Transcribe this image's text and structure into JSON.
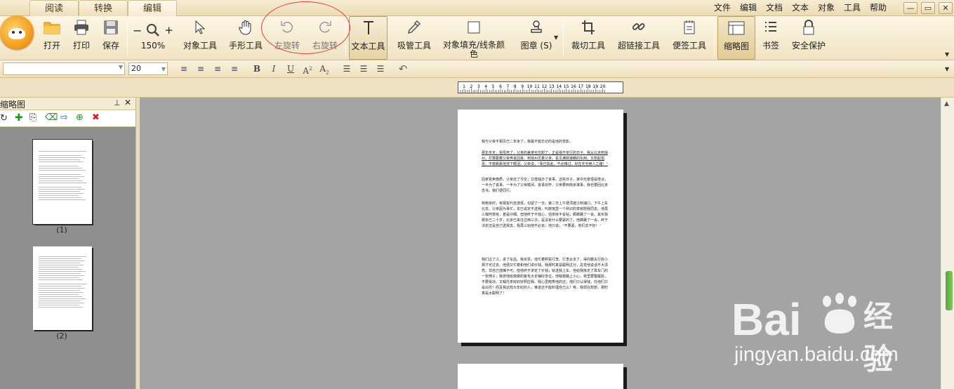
{
  "tabs": [
    "阅读",
    "转换",
    "编辑"
  ],
  "menu": [
    "文件",
    "编辑",
    "文档",
    "文本",
    "对象",
    "工具",
    "帮助"
  ],
  "window_controls": [
    "—",
    "▭",
    "✕"
  ],
  "ribbon": {
    "open": "打开",
    "print": "打印",
    "save": "保存",
    "zoom": "150%",
    "object_tool": "对象工具",
    "hand_tool": "手形工具",
    "rotate_left": "左旋转",
    "rotate_right": "右旋转",
    "text_tool": "文本工具",
    "eyedropper": "吸管工具",
    "fill_line_color": "对象填充/线条颜色",
    "stamp": "图章 (S)",
    "crop_tool": "裁切工具",
    "hyperlink_tool": "超链接工具",
    "note_tool": "便签工具",
    "thumbnails": "缩略图",
    "bookmarks": "书签",
    "security": "安全保护"
  },
  "format": {
    "font": "",
    "size": "20"
  },
  "ruler": {
    "ticks": [
      "1",
      "2",
      "3",
      "4",
      "5",
      "6",
      "7",
      "8",
      "9",
      "10",
      "11",
      "12",
      "13",
      "14",
      "15",
      "16",
      "17",
      "18",
      "19",
      "20"
    ]
  },
  "panel": {
    "title": "缩略图",
    "pages": [
      "(1)",
      "(2)"
    ]
  },
  "document": {
    "paragraphs": [
      "我与父亲不相见已二年余了，我最不能忘记的是他的背影。",
      "那年冬天，祖母死了，父亲的差使也交卸了，正是祸不单行的日子。我从北京到徐州，打算跟着父亲奔丧回家。到徐州见着父亲，看见满院狼藉的东西，又想起祖母，不禁簌簌地流下眼泪。父亲说，“事已如此，不必难过，好在天无绝人之路！”",
      "回家变卖典质，父亲还了亏空；又借钱办了丧事。这些日子，家中光景很是惨淡，一半为了丧事，一半为了父亲赋闲。丧事完毕，父亲要到南京谋事，我也要回北京念书，我们便同行。",
      "到南京时，有朋友约去游逛，勾留了一日；第二日上午便须渡江到浦口，下午上车北去。父亲因为事忙，本已说定不送我，叫旅馆里一个熟识的茶房陪我同去。他再三嘱咐茶房，甚是仔细。但他终于不放心，怕茶房不妥帖；颇踌躇了一会。其实我那年已二十岁，北京已来往过两三次，是没有什么要紧的了。他踌躇了一会，终于决定还是自己送我去。我再三劝他不必去；他只说，“不要紧，他们去不好！”",
      "我们过了江，进了车站。我买票，他忙着照看行李。行李太多了，得向脚夫行些小费才可过去。他便又忙着和他们讲价钱。我那时真是聪明过分，总觉他说话不大漂亮，非自己插嘴不可。但他终于讲定了价钱；就送我上车。他给我拣定了靠车门的一张椅子；我将他给我做的紫毛大衣铺好坐位。他嘱我路上小心，夜里要警醒些，不要受凉。又嘱托茶房好好照应我。我心里暗笑他的迂；他们只认得钱，托他们只是白托！而且我这样大年纪的人，难道还不能料理自己么？唉，我现在想想，那时真是太聪明了！"
    ]
  },
  "watermark": {
    "brand": "Bai",
    "brand2": "经验",
    "url": "jingyan.baidu.com"
  }
}
